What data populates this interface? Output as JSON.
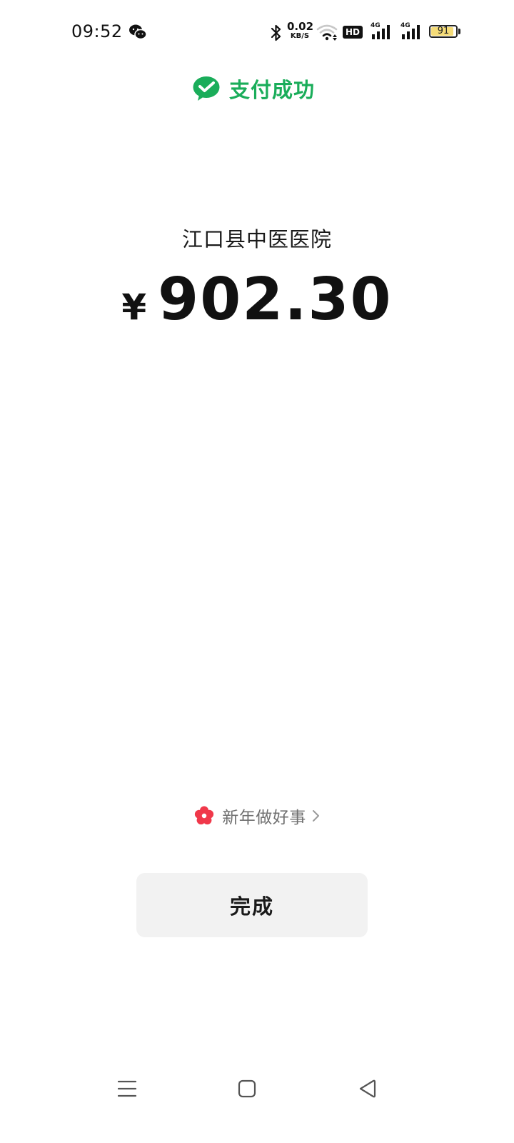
{
  "status_bar": {
    "time": "09:52",
    "net_speed_value": "0.02",
    "net_speed_unit": "KB/S",
    "hd_label": "HD",
    "signal_1_label": "4G",
    "signal_2_label": "4G",
    "battery_level": "91",
    "battery_fraction": 0.91,
    "battery_fill_color": "#f5dc78"
  },
  "header": {
    "title": "支付成功",
    "accent_color": "#1aad5a"
  },
  "payment": {
    "merchant": "江口县中医医院",
    "currency_symbol": "¥",
    "amount": "902.30"
  },
  "charity": {
    "label": "新年做好事",
    "icon": "red-flower-icon",
    "icon_color": "#f0384a"
  },
  "actions": {
    "done_label": "完成"
  },
  "nav_bar": {
    "icons": [
      "menu-icon",
      "home-square-icon",
      "back-triangle-icon"
    ]
  }
}
